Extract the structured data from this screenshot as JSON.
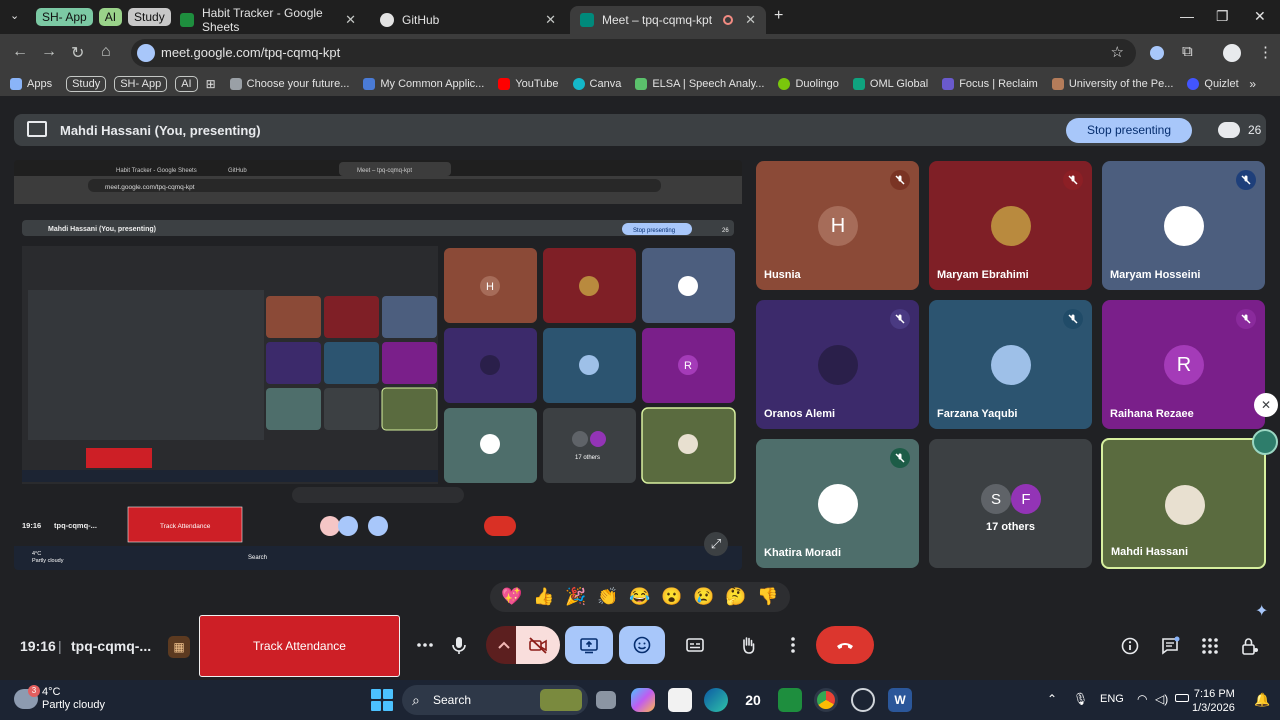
{
  "browser": {
    "tab_groups": [
      {
        "label": "SH- App",
        "color": "#7cc9a4"
      },
      {
        "label": "AI",
        "color": "#9ad38a"
      },
      {
        "label": "Study",
        "color": "#c8c8c8"
      }
    ],
    "tabs": [
      {
        "title": "Habit Tracker - Google Sheets",
        "active": false
      },
      {
        "title": "GitHub",
        "active": false
      },
      {
        "title": "Meet – tpq-cqmq-kpt",
        "active": true
      }
    ],
    "new_tab": "+",
    "url": "meet.google.com/tpq-cqmq-kpt",
    "bookmarks": [
      {
        "label": "Apps",
        "color": "#8ab4f8"
      },
      {
        "label": "Choose your future...",
        "color": "#9aa0a6"
      },
      {
        "label": "My Common Applic...",
        "color": "#4a7bd6"
      },
      {
        "label": "YouTube",
        "color": "#ff0000"
      },
      {
        "label": "Canva",
        "color": "#14b7c9"
      },
      {
        "label": "ELSA | Speech Analy...",
        "color": "#5bc16c"
      },
      {
        "label": "Duolingo",
        "color": "#7ac70c"
      },
      {
        "label": "OML Global",
        "color": "#0fa37f"
      },
      {
        "label": "Focus | Reclaim",
        "color": "#6a5acd"
      },
      {
        "label": "University of the Pe...",
        "color": "#b47c5a"
      },
      {
        "label": "Quizlet",
        "color": "#4255ff"
      }
    ],
    "bookmark_pills": [
      "Study",
      "SH- App",
      "AI"
    ]
  },
  "meet": {
    "presenting_title": "Mahdi Hassani (You, presenting)",
    "stop_presenting": "Stop presenting",
    "participant_count": "26",
    "participants": [
      {
        "name": "Husnia",
        "initial": "H",
        "bg": "#8b4a37",
        "avatar_bg": "#a66c59",
        "muted_bg": "#7a3424"
      },
      {
        "name": "Maryam Ebrahimi",
        "initial": "",
        "bg": "#7f1f26",
        "avatar_bg": "#b98a3e",
        "muted_bg": "#8c1f25"
      },
      {
        "name": "Maryam Hosseini",
        "initial": "",
        "bg": "#4c5e7e",
        "avatar_bg": "#ffffff",
        "muted_bg": "#1e3f7a"
      },
      {
        "name": "Oranos Alemi",
        "initial": "",
        "bg": "#3c2a6b",
        "avatar_bg": "#3a2f5c",
        "muted_bg": "#4a3a82"
      },
      {
        "name": "Farzana Yaqubi",
        "initial": "",
        "bg": "#2c5470",
        "avatar_bg": "#9ec0e8",
        "muted_bg": "#204b68"
      },
      {
        "name": "Raihana Rezaee",
        "initial": "R",
        "bg": "#7a1f8a",
        "avatar_bg": "#a43bb8",
        "muted_bg": "#8a2a9c"
      },
      {
        "name": "Khatira Moradi",
        "initial": "",
        "bg": "#4e6e6b",
        "avatar_bg": "#ffffff",
        "muted_bg": "#1d5c47"
      },
      {
        "name": "17 others",
        "initial": "",
        "bg": "#3c4043",
        "avatar_bg": "#3c4043",
        "muted_bg": ""
      },
      {
        "name": "Mahdi Hassani",
        "initial": "",
        "bg": "#5a6b3f",
        "avatar_bg": "#e8e0d0",
        "muted_bg": ""
      }
    ],
    "others_initials": [
      {
        "letter": "S",
        "color": "#5f6368"
      },
      {
        "letter": "F",
        "color": "#9334b6"
      }
    ],
    "reactions": [
      "💖",
      "👍",
      "🎉",
      "👏",
      "😂",
      "😮",
      "😢",
      "🤔",
      "👎"
    ],
    "time": "19:16",
    "meeting_code": "tpq-cqmq-...",
    "separator": "|",
    "track_attendance": "Track Attendance"
  },
  "mini": {
    "url": "meet.google.com/tpq-cqmq-kpt",
    "tabs": [
      "Habit Tracker - Google Sheets",
      "GitHub",
      "Meet – tpq-cqmq-kpt"
    ],
    "present_title": "Mahdi Hassani (You, presenting)",
    "stop": "Stop presenting",
    "count": "26",
    "time": "19:16",
    "code": "tpq-cqmq-...",
    "track": "Track Attendance",
    "search": "Search",
    "others": "17 others",
    "weather_temp": "4°C",
    "weather_desc": "Partly cloudy"
  },
  "taskbar": {
    "weather_badge": "3",
    "weather_temp": "4°C",
    "weather_desc": "Partly cloudy",
    "search": "Search",
    "lang": "ENG",
    "time": "7:16 PM",
    "date": "1/3/2026"
  }
}
